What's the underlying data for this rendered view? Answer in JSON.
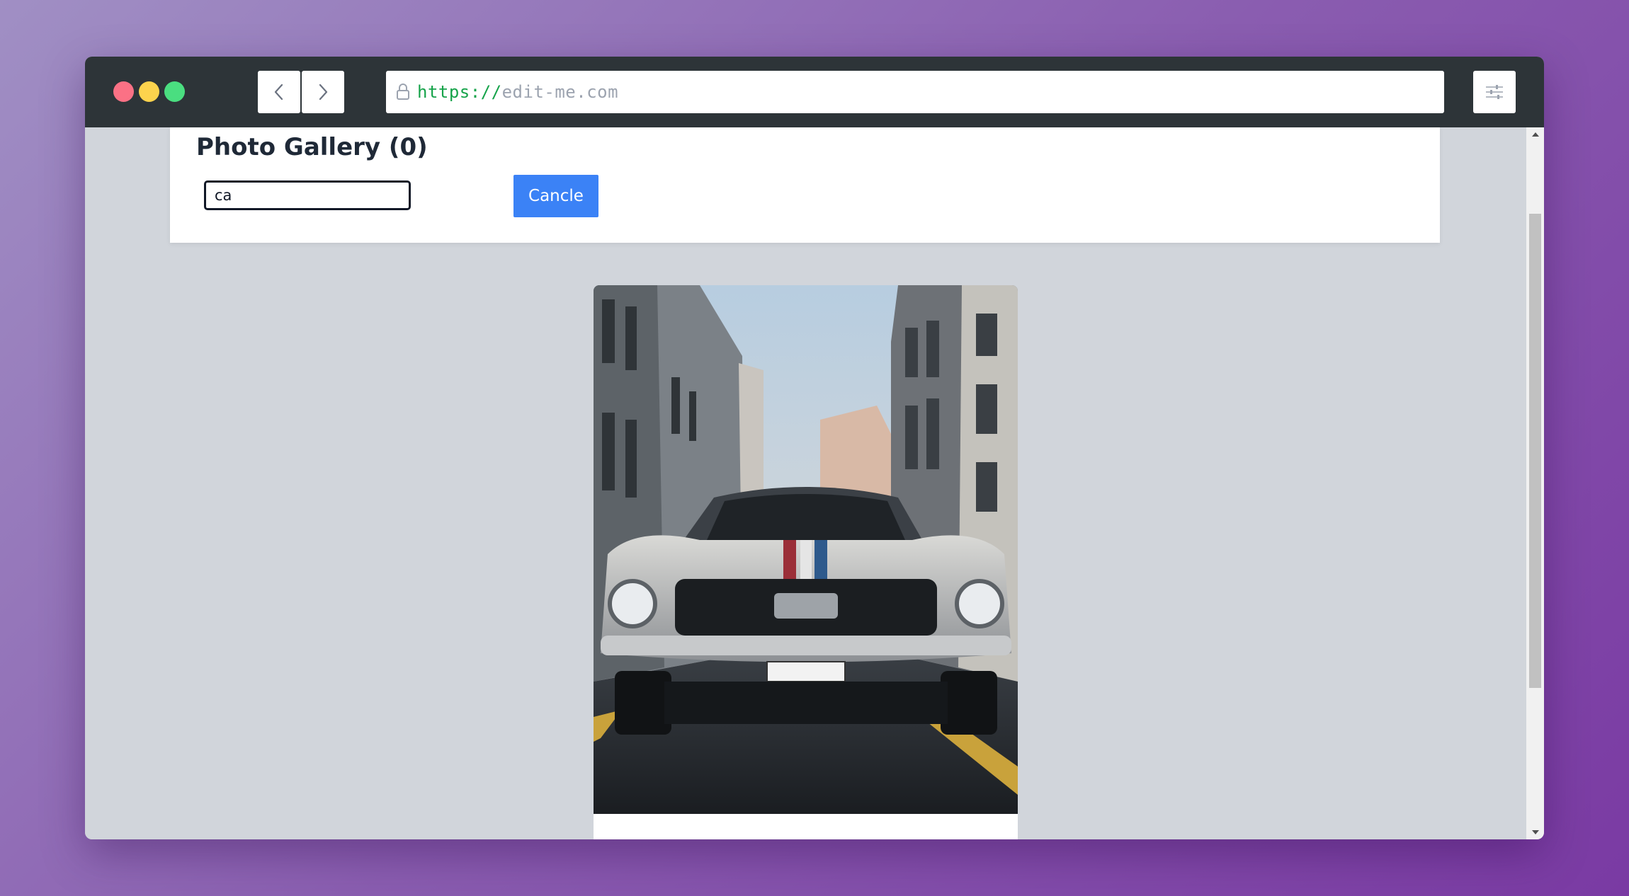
{
  "browser": {
    "url_scheme": "https://",
    "url_host": "edit-me.com",
    "back_icon": "chevron-left-icon",
    "forward_icon": "chevron-right-icon",
    "menu_icon": "sliders-icon",
    "lock_icon": "lock-icon"
  },
  "page": {
    "title": "Photo Gallery (0)",
    "search": {
      "value": "ca",
      "placeholder": ""
    },
    "cancel_label": "Cancle"
  },
  "gallery": {
    "items": [
      {
        "image": "vintage white car with red and blue stripes on a city street"
      }
    ]
  },
  "colors": {
    "accent": "#3b82f6",
    "titlebar": "#2d3438",
    "viewport_bg": "#d1d5db",
    "url_scheme": "#16a34a"
  }
}
